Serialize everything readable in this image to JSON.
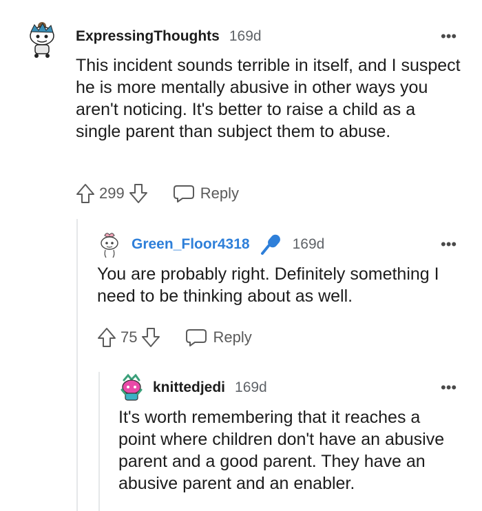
{
  "comments": [
    {
      "username": "ExpressingThoughts",
      "timestamp": "169d",
      "body": "This incident sounds terrible in itself, and I suspect he is more mentally abusive in other ways you aren't noticing. It's better to raise a child as a single parent than subject them to abuse.",
      "score": "299",
      "reply_label": "Reply",
      "more_label": "•••"
    },
    {
      "username": "Green_Floor4318",
      "timestamp": "169d",
      "body": "You are probably right. Definitely something I need to be thinking about as well.",
      "score": "75",
      "reply_label": "Reply",
      "more_label": "•••"
    },
    {
      "username": "knittedjedi",
      "timestamp": "169d",
      "body": "It's worth remembering that it reaches a point where children don't have an abusive parent and a good parent. They have an abusive parent and an enabler.",
      "more_label": "•••"
    }
  ],
  "colors": {
    "op_username": "#2e7fd9",
    "thread_line": "#e5e7e9",
    "text": "#1c1c1c",
    "muted": "#5f6368"
  },
  "icons": [
    "upvote-icon",
    "downvote-icon",
    "reply-bubble-icon",
    "microphone-icon",
    "more-options-icon"
  ]
}
